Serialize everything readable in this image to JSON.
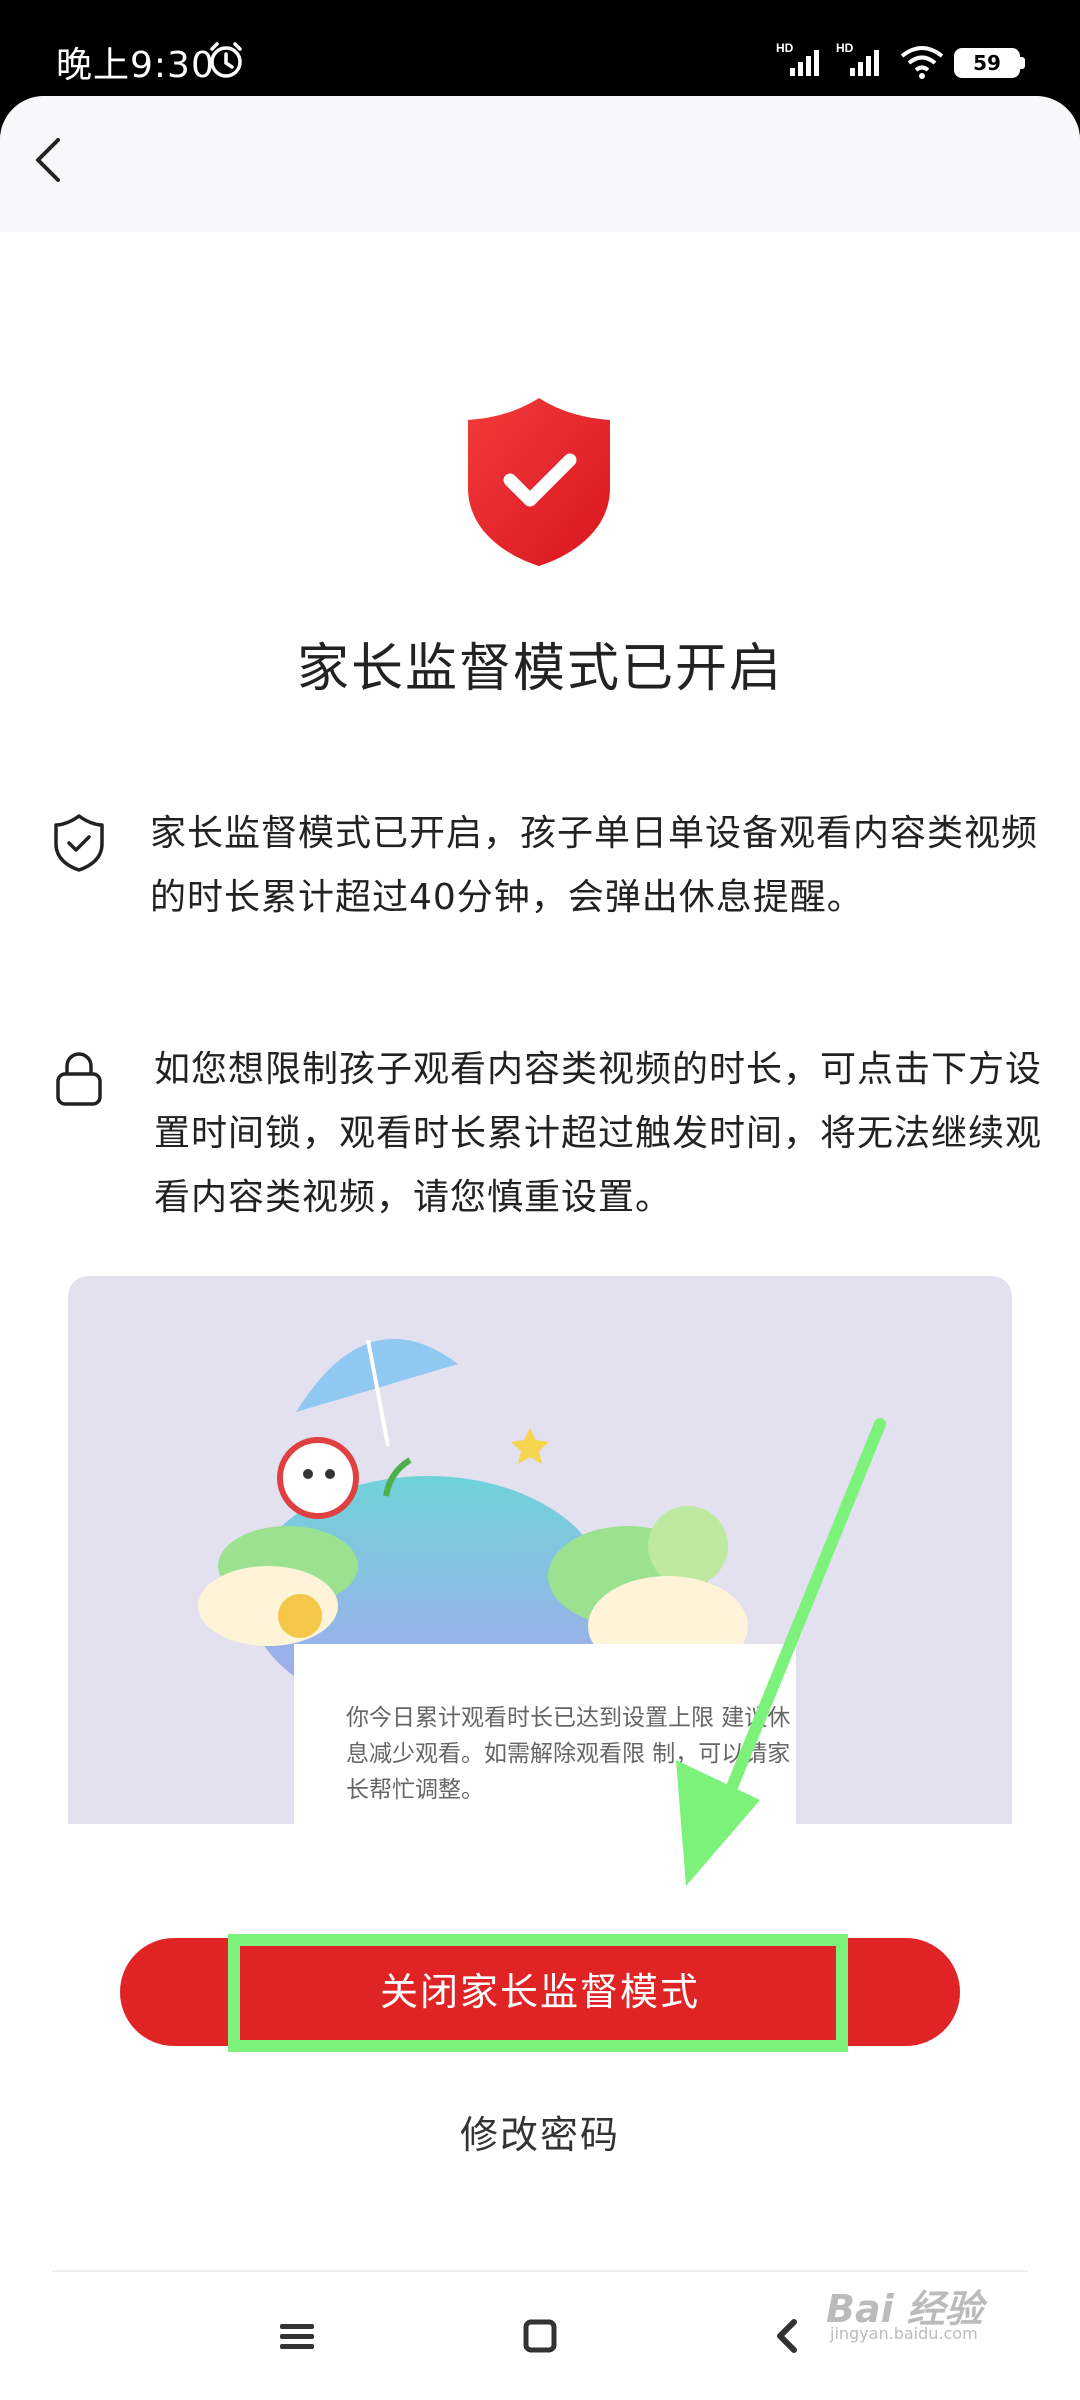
{
  "status_bar": {
    "time": "晚上9:30",
    "signal_1_label": "HD",
    "signal_2_label": "HD",
    "battery_level": "59"
  },
  "hero": {
    "title": "家长监督模式已开启",
    "icon": "shield-check-icon",
    "icon_color": "#e8202a"
  },
  "info": [
    {
      "icon": "shield-check-outline-icon",
      "text": "家长监督模式已开启，孩子单日单设备观看内容类视频的时长累计超过40分钟，会弹出休息提醒。"
    },
    {
      "icon": "lock-icon",
      "text": "如您想限制孩子观看内容类视频的时长，可点击下方设置时间锁，观看时长累计超过触发时间，将无法继续观看内容类视频，请您慎重设置。"
    }
  ],
  "illustration": {
    "card_text": "你今日累计观看时长已达到设置上限 建议休息减少观看。如需解除观看限 制，可以请家长帮忙调整。"
  },
  "actions": {
    "close_mode_label": "关闭家长监督模式",
    "change_password_label": "修改密码",
    "primary_color": "#e02426",
    "highlight_color": "#7cf27a"
  },
  "nav": {
    "menu_icon": "menu-icon",
    "home_icon": "home-square-icon",
    "back_icon": "back-triangle-icon"
  },
  "watermark": {
    "text": "Bai 经验",
    "sub": "jingyan.baidu.com"
  }
}
